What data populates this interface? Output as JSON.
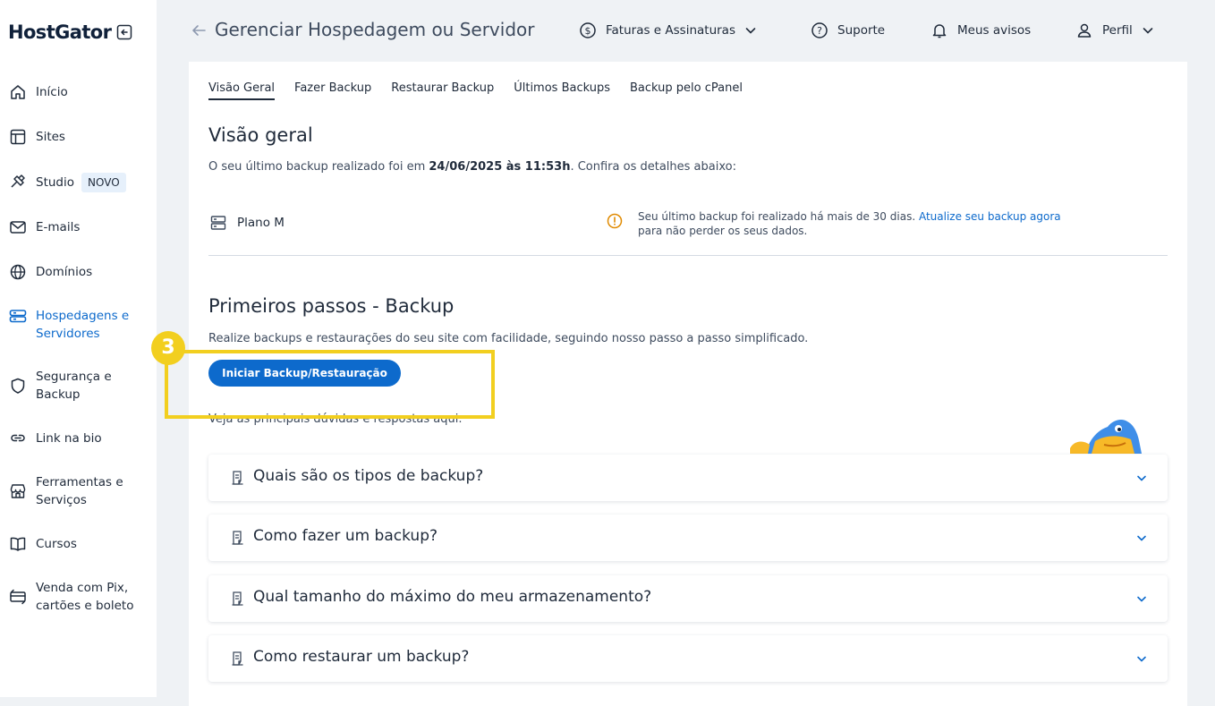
{
  "brand": {
    "name": "HostGator"
  },
  "sidebar": {
    "items": [
      {
        "label": "Início",
        "icon": "home-icon"
      },
      {
        "label": "Sites",
        "icon": "layout-icon"
      },
      {
        "label": "Studio",
        "badge": "NOVO",
        "icon": "studio-icon"
      },
      {
        "label": "E-mails",
        "icon": "mail-icon"
      },
      {
        "label": "Domínios",
        "icon": "globe-icon"
      },
      {
        "label": "Hospedagens e\nServidores",
        "icon": "server-icon",
        "active": true
      },
      {
        "label": "Segurança e\nBackup",
        "icon": "shield-icon"
      },
      {
        "label": "Link na bio",
        "icon": "link-icon"
      },
      {
        "label": "Ferramentas e\nServiços",
        "icon": "store-icon"
      },
      {
        "label": "Cursos",
        "icon": "book-icon"
      },
      {
        "label": "Venda com Pix,\ncartões e boleto",
        "icon": "payment-icon"
      }
    ]
  },
  "header": {
    "title": "Gerenciar Hospedagem ou Servidor",
    "billing": "Faturas e Assinaturas",
    "support": "Suporte",
    "notices": "Meus avisos",
    "profile": "Perfil"
  },
  "tabs": [
    "Visão Geral",
    "Fazer Backup",
    "Restaurar Backup",
    "Últimos Backups",
    "Backup pelo cPanel"
  ],
  "overview": {
    "title": "Visão geral",
    "desc_prefix": "O seu último backup realizado foi em ",
    "desc_date": "24/06/2025 às 11:53h",
    "desc_suffix": ". Confira os detalhes abaixo:",
    "plan": "Plano M",
    "warning_text": "Seu último backup foi realizado há mais de 30 dias.",
    "warning_link": "Atualize seu backup agora",
    "warning_text2": "para não perder os seus dados."
  },
  "first_steps": {
    "title": "Primeiros passos - Backup",
    "desc": "Realize backups e restaurações do seu site com facilidade, seguindo nosso passo a passo simplificado.",
    "button": "Iniciar Backup/Restauração",
    "faq_intro": "Veja as principais dúvidas e respostas aqui:"
  },
  "faq": [
    "Quais são os tipos de backup?",
    "Como fazer um backup?",
    "Qual tamanho do máximo do meu armazenamento?",
    "Como restaurar um backup?"
  ],
  "annotation": {
    "step": "3",
    "color": "#f2cf1f"
  },
  "colors": {
    "accent": "#0d6acc",
    "sidebar_bg": "#ffffff",
    "page_bg": "#eff2f5"
  }
}
